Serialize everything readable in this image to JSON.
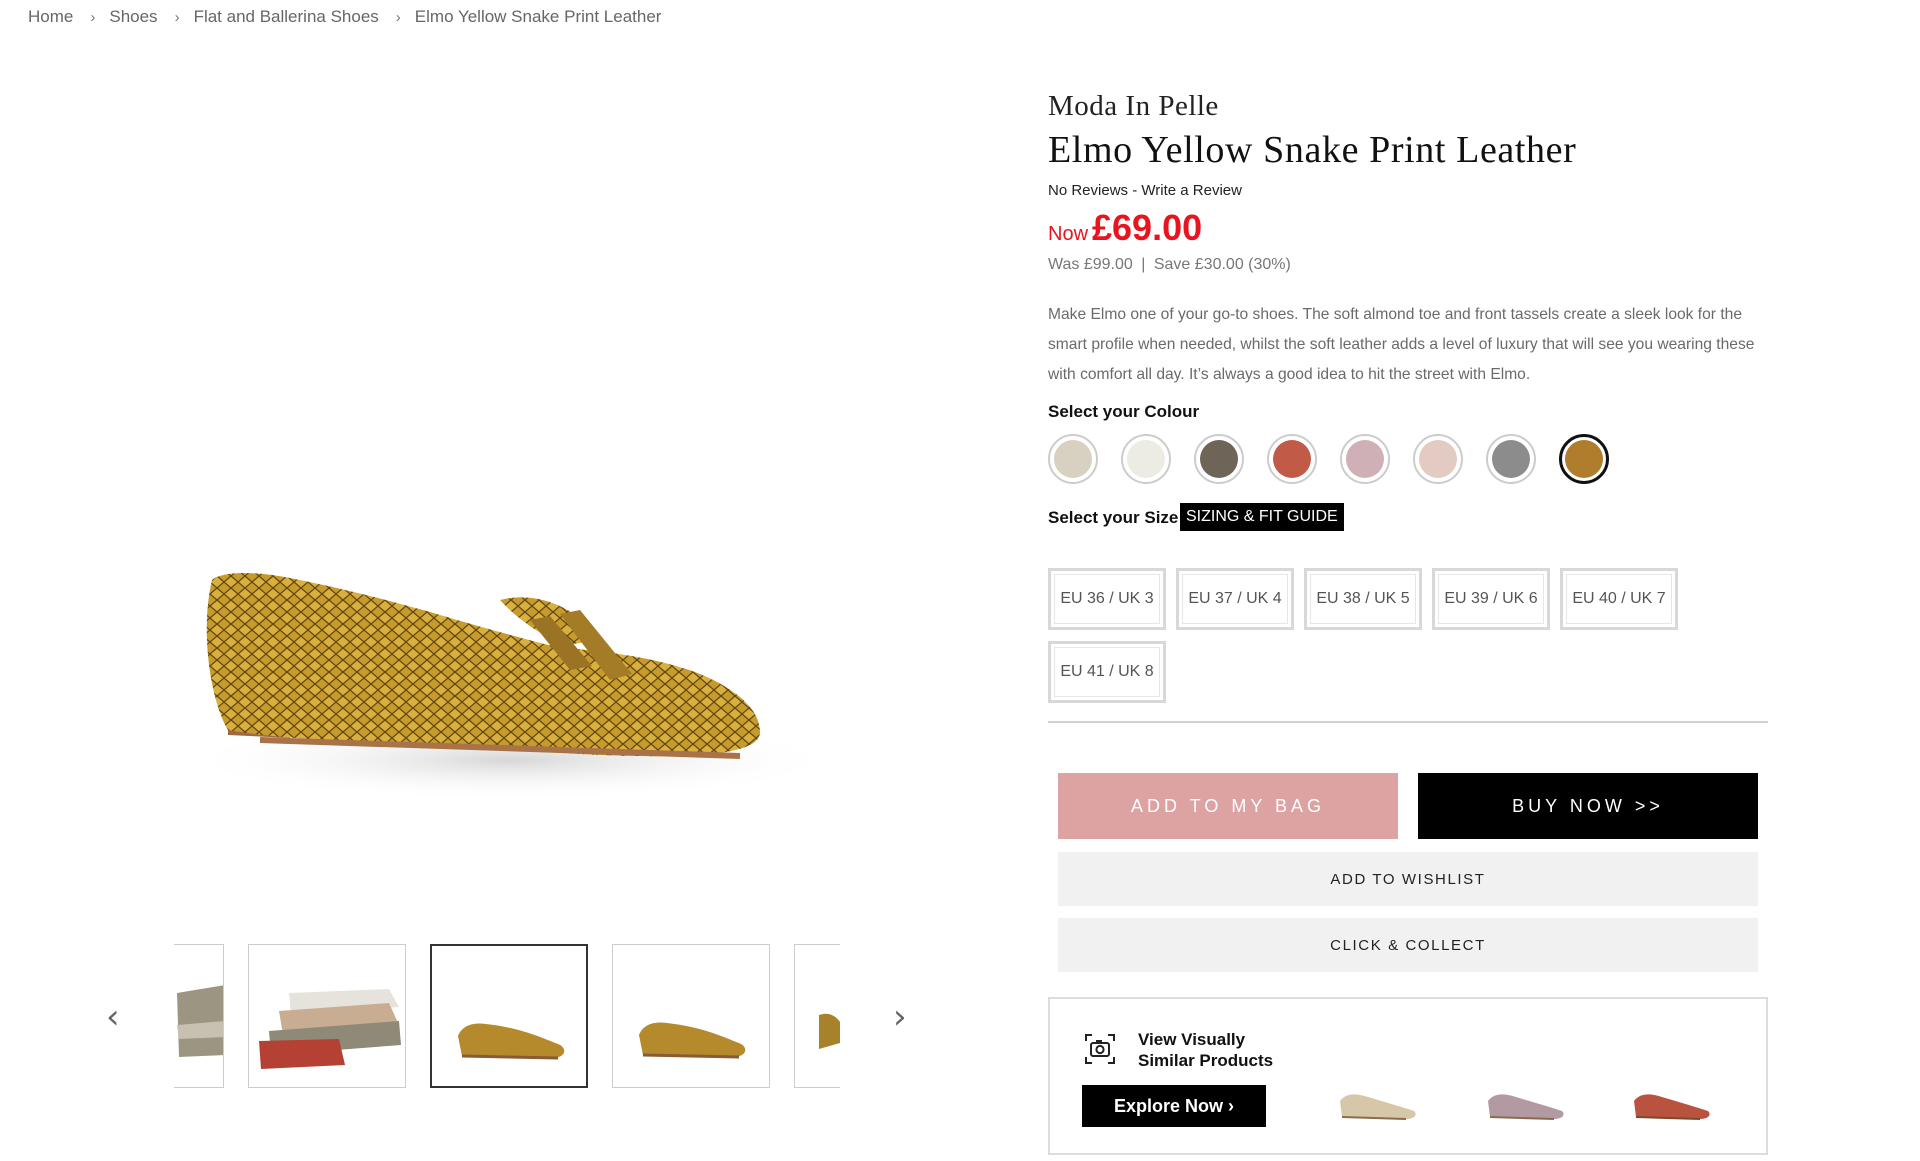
{
  "breadcrumb": {
    "home": "Home",
    "shoes": "Shoes",
    "category": "Flat and Ballerina Shoes",
    "current": "Elmo Yellow Snake Print Leather",
    "separator": "›"
  },
  "gallery": {
    "prev_arrow": "‹",
    "next_arrow": "›",
    "thumbnail_count_visible": 5,
    "active_thumbnail_index": 2
  },
  "product": {
    "brand": "Moda In Pelle",
    "title": "Elmo Yellow Snake Print Leather",
    "reviews_text": "No Reviews",
    "reviews_sep": " - ",
    "write_review": "Write a Review",
    "now_label": "Now",
    "price_now": "£69.00",
    "price_was": "Was £99.00",
    "price_sep": "|",
    "price_save": "Save £30.00 (30%)",
    "description": "Make Elmo one of your go-to shoes. The soft almond toe and front tassels create a sleek look for the smart profile when needed, whilst the soft leather adds a level of luxury that will see you wearing these with comfort all day. It’s always a good idea to hit the street with Elmo.",
    "colour_label": "Select your Colour",
    "size_label": "Select your Size",
    "fit_guide": "SIZING & FIT GUIDE"
  },
  "colours": [
    {
      "color": "#d8d0c0"
    },
    {
      "color": "#ecebe4"
    },
    {
      "color": "#6e6458"
    },
    {
      "color": "#c25a48"
    },
    {
      "color": "#cfb0b6"
    },
    {
      "color": "#e3cbc3"
    },
    {
      "color": "#8c8c8c"
    },
    {
      "color": "#b07d2c",
      "selected": true
    }
  ],
  "sizes": [
    "EU 36 / UK 3",
    "EU 37 / UK 4",
    "EU 38 / UK 5",
    "EU 39 / UK 6",
    "EU 40 / UK 7",
    "EU 41 / UK 8"
  ],
  "actions": {
    "add_to_bag": "ADD TO MY BAG",
    "buy_now": "BUY NOW >>",
    "wishlist": "ADD TO WISHLIST",
    "click_collect": "CLICK & COLLECT"
  },
  "similar": {
    "title": "View Visually Similar Products",
    "explore": "Explore Now ›"
  },
  "colors_theme": {
    "sale_red": "#e8141f",
    "add_bag_pink": "#dda3a3",
    "black": "#000000"
  }
}
